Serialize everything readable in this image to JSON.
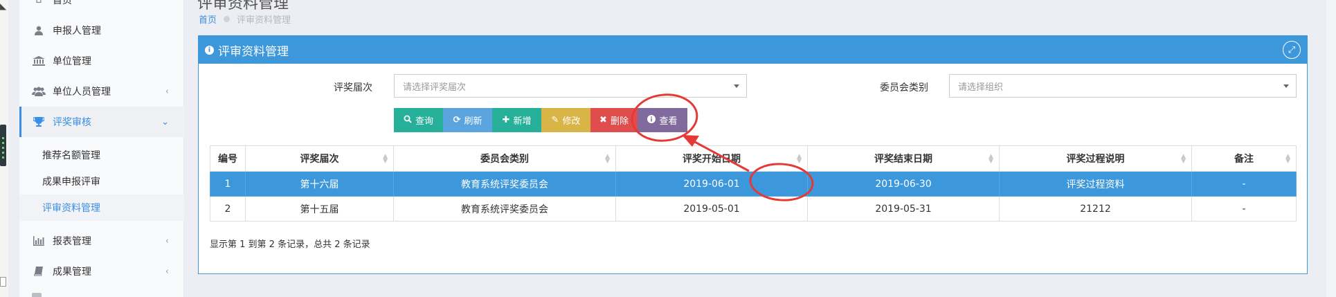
{
  "page": {
    "heading": "评审资料管理",
    "breadcrumb_home": "首页",
    "breadcrumb_current": "评审资料管理"
  },
  "sidebar": {
    "items": [
      {
        "label": "首页",
        "icon": "home-icon"
      },
      {
        "label": "申报人管理",
        "icon": "user-icon"
      },
      {
        "label": "单位管理",
        "icon": "bank-icon"
      },
      {
        "label": "单位人员管理",
        "icon": "users-icon"
      },
      {
        "label": "评奖审核",
        "icon": "trophy-icon"
      },
      {
        "label": "报表管理",
        "icon": "bar-chart-icon"
      },
      {
        "label": "成果管理",
        "icon": "book-icon"
      }
    ],
    "sub_items": [
      "推荐名额管理",
      "成果申报评审",
      "评审资料管理"
    ]
  },
  "panel": {
    "title": "评审资料管理"
  },
  "filters": {
    "session_label": "评奖届次",
    "session_placeholder": "请选择评奖届次",
    "committee_label": "委员会类别",
    "committee_placeholder": "请选择组织"
  },
  "toolbar": {
    "query": "查询",
    "refresh": "刷新",
    "add": "新增",
    "edit": "修改",
    "delete": "删除",
    "view": "查看"
  },
  "table": {
    "columns": [
      "编号",
      "评奖届次",
      "委员会类别",
      "评奖开始日期",
      "评奖结束日期",
      "评奖过程说明",
      "备注"
    ],
    "rows": [
      [
        "1",
        "第十六届",
        "教育系统评奖委员会",
        "2019-06-01",
        "2019-06-30",
        "评奖过程资料",
        "-"
      ],
      [
        "2",
        "第十五届",
        "教育系统评奖委员会",
        "2019-05-01",
        "2019-05-31",
        "21212",
        "-"
      ]
    ],
    "summary": "显示第 1 到第 2 条记录，总共 2 条记录"
  },
  "colors": {
    "primary": "#3c97db",
    "teal": "#26b09a",
    "danger": "#e04d4d",
    "warning": "#d9b446",
    "purple": "#806a9e",
    "annotation": "#e53935"
  }
}
